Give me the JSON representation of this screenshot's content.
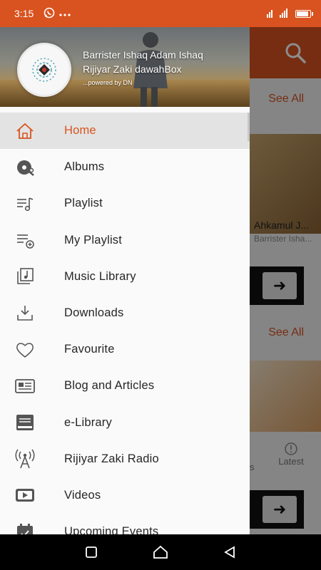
{
  "status_bar": {
    "time": "3:15",
    "network": "4G",
    "battery_level": 0.9
  },
  "background_app": {
    "see_all_1": "See All",
    "see_all_2": "See All",
    "card_title": "Ahkamul J...",
    "card_subtitle": "Barrister Isha...",
    "tab_partial": "s",
    "tab_latest": "Latest"
  },
  "drawer": {
    "header": {
      "name_line1": "Barrister Ishaq Adam Ishaq",
      "name_line2": "Rijiyar Zaki dawahBox",
      "powered_by": "...powered by DN"
    },
    "items": [
      {
        "label": "Home",
        "icon": "home-icon",
        "active": true
      },
      {
        "label": "Albums",
        "icon": "album-disc-icon"
      },
      {
        "label": "Playlist",
        "icon": "playlist-icon"
      },
      {
        "label": "My Playlist",
        "icon": "playlist-add-icon"
      },
      {
        "label": "Music Library",
        "icon": "music-library-icon"
      },
      {
        "label": "Downloads",
        "icon": "download-icon"
      },
      {
        "label": "Favourite",
        "icon": "heart-icon"
      },
      {
        "label": "Blog and Articles",
        "icon": "newspaper-icon"
      },
      {
        "label": "e-Library",
        "icon": "book-icon"
      },
      {
        "label": "Rijiyar Zaki Radio",
        "icon": "radio-tower-icon"
      },
      {
        "label": "Videos",
        "icon": "video-icon"
      },
      {
        "label": "Upcoming Events",
        "icon": "calendar-icon"
      }
    ]
  },
  "colors": {
    "accent": "#d8531f",
    "drawer_bg": "#fafafa",
    "active_item_bg": "#e3e3e3",
    "text": "#262626"
  }
}
